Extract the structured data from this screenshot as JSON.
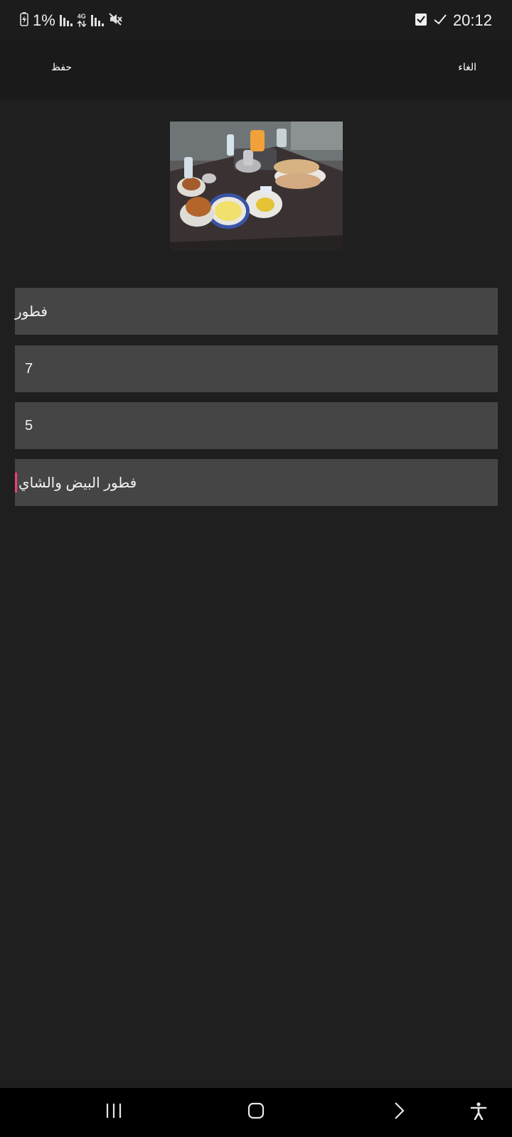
{
  "status_bar": {
    "battery_percent": "1%",
    "network_type": "4G",
    "time": "20:12",
    "icons": [
      "battery-charging-icon",
      "signal-icon",
      "data-arrows-icon",
      "signal-icon",
      "mute-icon",
      "checkbox-icon",
      "check-icon"
    ]
  },
  "app_bar": {
    "save_label": "حفظ",
    "cancel_label": "الغاء"
  },
  "photo": {
    "description_icon": "breakfast-photo"
  },
  "form": {
    "name_value": "فطور",
    "field2_value": "7",
    "field3_value": "5",
    "description_value": "فطور البيض والشاي"
  },
  "nav_bar": {
    "icons": [
      "recents-icon",
      "home-icon",
      "back-icon",
      "accessibility-icon"
    ]
  },
  "colors": {
    "background": "#1f1f1f",
    "field": "#454545",
    "cursor": "#e8417a"
  }
}
